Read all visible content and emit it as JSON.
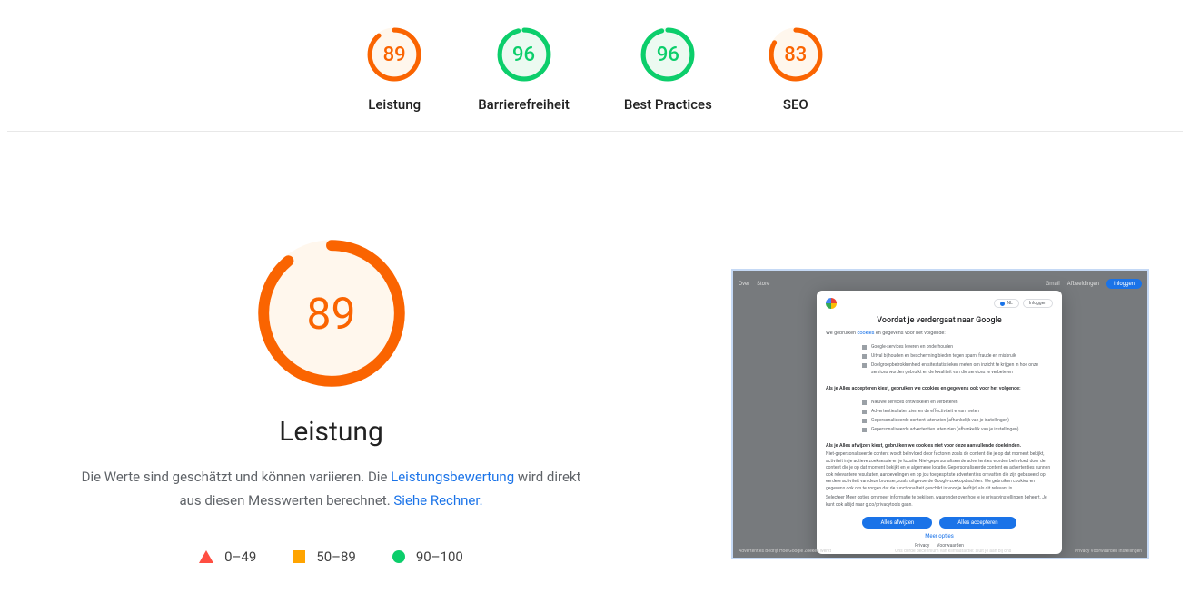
{
  "colors": {
    "orange": "#fa6401",
    "orange_bg": "#fff7ed",
    "green": "#0cce6b",
    "green_bg": "#ecfaf1",
    "red": "#ff4e42"
  },
  "gauges": [
    {
      "id": "performance",
      "label": "Leistung",
      "score": 89,
      "color": "orange"
    },
    {
      "id": "accessibility",
      "label": "Barrierefreiheit",
      "score": 96,
      "color": "green"
    },
    {
      "id": "best-practices",
      "label": "Best Practices",
      "score": 96,
      "color": "green"
    },
    {
      "id": "seo",
      "label": "SEO",
      "score": 83,
      "color": "orange"
    }
  ],
  "big_gauge": {
    "label": "Leistung",
    "score": 89,
    "color": "orange"
  },
  "description": {
    "part1": "Die Werte sind geschätzt und können variieren. Die ",
    "link1": "Leistungsbewertung",
    "part2": " wird direkt aus diesen Messwerten berechnet. ",
    "link2": "Siehe Rechner."
  },
  "legend": [
    {
      "shape": "triangle",
      "label": "0–49"
    },
    {
      "shape": "square",
      "label": "50–89"
    },
    {
      "shape": "circle",
      "label": "90–100"
    }
  ],
  "thumbnail": {
    "top_left_links": [
      "Over",
      "Store"
    ],
    "top_right_links": [
      "Gmail",
      "Afbeeldingen"
    ],
    "top_right_pill": "NL",
    "top_right_button": "Inloggen",
    "footer_left": "Advertenties  Bedrijf  Hoe Google Zoeken werkt",
    "footer_mid": "Ons derde decennium van klimaatactie: sluit je aan bij ons",
    "footer_right": "Privacy  Voorwaarden  Instellingen",
    "modal": {
      "lang_pill": "NL",
      "signin": "Inloggen",
      "title": "Voordat je verdergaat naar Google",
      "sub_prefix": "We gebruiken ",
      "sub_cookies": "cookies",
      "sub_suffix": " en gegevens voor het volgende:",
      "bullets1": [
        "Google-services leveren en onderhouden",
        "Uitval bijhouden en bescherming bieden tegen spam, fraude en misbruik",
        "Doelgroepbetrokkenheid en sitestatistieken meten om inzicht te krijgen in hoe onze services worden gebruikt en de kwaliteit van die services te verbeteren"
      ],
      "bold_sub1": "Als je Alles accepteren kiest, gebruiken we cookies en gegevens ook voor het volgende:",
      "bullets2": [
        "Nieuwe services ontwikkelen en verbeteren",
        "Advertenties laten zien en de effectiviteit ervan meten",
        "Gepersonaliseerde content laten zien (afhankelijk van je instellingen)",
        "Gepersonaliseerde advertenties laten zien (afhankelijk van je instellingen)"
      ],
      "bold_sub2": "Als je Alles afwijzen kiest, gebruiken we cookies niet voor deze aanvullende doeleinden.",
      "para1": "Niet-gepersonaliseerde content wordt beïnvloed door factoren zoals de content die je op dat moment bekijkt, activiteit in je actieve zoeksessie en je locatie. Niet-gepersonaliseerde advertenties worden beïnvloed door de content die je op dat moment bekijkt en je algemene locatie. Gepersonaliseerde content en advertenties kunnen ook relevantere resultaten, aanbevelingen en op jou toegespitste advertenties omvatten die zijn gebaseerd op eerdere activiteit van deze browser, zoals uitgevoerde Google-zoekopdrachten. We gebruiken cookies en gegevens ook om te zorgen dat de functionaliteit geschikt is voor je leeftijd, als dit relevant is.",
      "para2": "Selecteer Meer opties om meer informatie te bekijken, waaronder over hoe je je privacyinstellingen beheert. Je kunt ook altijd naar g.co/privacytools gaan.",
      "btn_reject": "Alles afwijzen",
      "btn_accept": "Alles accepteren",
      "more_options": "Meer opties",
      "footer": [
        "Privacy",
        "Voorwaarden"
      ]
    }
  }
}
